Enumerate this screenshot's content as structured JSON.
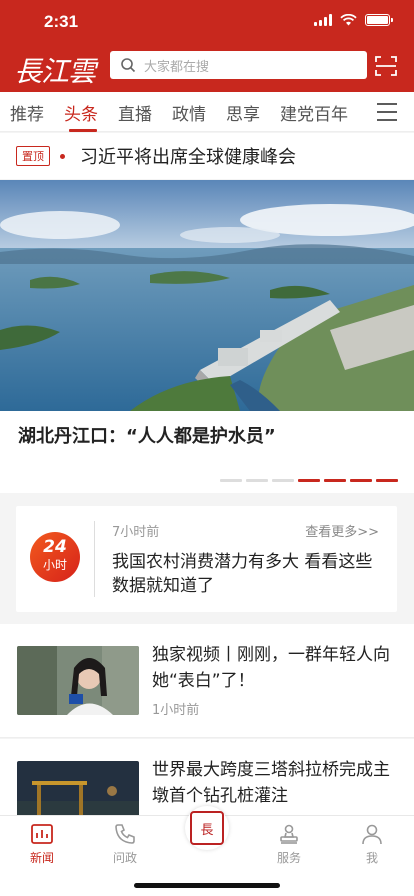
{
  "status_bar": {
    "time": "2:31"
  },
  "header": {
    "logo": "長江雲",
    "search_placeholder": "大家都在搜",
    "accent_color": "#c8281e"
  },
  "tabs": [
    {
      "label": "推荐",
      "active": false
    },
    {
      "label": "头条",
      "active": true
    },
    {
      "label": "直播",
      "active": false
    },
    {
      "label": "政情",
      "active": false
    },
    {
      "label": "思享",
      "active": false
    },
    {
      "label": "建党百年",
      "active": false
    }
  ],
  "pinned": {
    "badge": "置顶",
    "title": "习近平将出席全球健康峰会"
  },
  "hero": {
    "title": "湖北丹江口：“人人都是护水员”",
    "slides_total": 7,
    "slides_active": 4
  },
  "card24": {
    "badge_num": "24",
    "badge_unit": "小时",
    "time": "7小时前",
    "more": "查看更多>>",
    "text": "我国农村消费潜力有多大 看看这些数据就知道了"
  },
  "news": [
    {
      "title": "独家视频丨刚刚，一群年轻人向她“表白”了！",
      "time": "1小时前"
    },
    {
      "title": "世界最大跨度三塔斜拉桥完成主墩首个钻孔桩灌注",
      "time": ""
    }
  ],
  "bottom_nav": [
    {
      "label": "新闻",
      "icon": "news-icon",
      "active": true
    },
    {
      "label": "问政",
      "icon": "phone-icon",
      "active": false
    },
    {
      "label": "",
      "icon": "changjiang-seal-icon",
      "active": false
    },
    {
      "label": "服务",
      "icon": "service-icon",
      "active": false
    },
    {
      "label": "我",
      "icon": "user-icon",
      "active": false
    }
  ]
}
